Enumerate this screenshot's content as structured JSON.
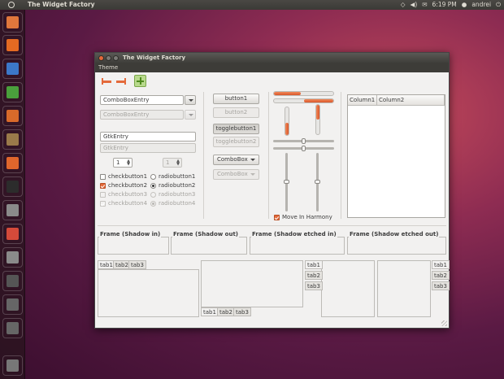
{
  "top_panel": {
    "app_title": "The Widget Factory",
    "clock": "6:19 PM",
    "user": "andrei",
    "indicator_icons": [
      "network-icon",
      "volume-icon",
      "mail-icon",
      "power-icon"
    ]
  },
  "launcher": {
    "items": [
      {
        "name": "home-folder",
        "color": "#e0773c"
      },
      {
        "name": "firefox",
        "color": "#e46a22"
      },
      {
        "name": "libreoffice-writer",
        "color": "#3c78c8"
      },
      {
        "name": "libreoffice-calc",
        "color": "#4aa03c"
      },
      {
        "name": "libreoffice-impress",
        "color": "#d86a2a"
      },
      {
        "name": "shotwell",
        "color": "#9a7a4a"
      },
      {
        "name": "ubuntu-software-center",
        "color": "#e0662c"
      },
      {
        "name": "terminal",
        "color": "#2c2c2c"
      },
      {
        "name": "text-editor",
        "color": "#8a8a8a"
      },
      {
        "name": "system-settings",
        "color": "#d44a3a"
      },
      {
        "name": "help",
        "color": "#8a8a8a"
      },
      {
        "name": "workspace-switcher",
        "color": "#555555"
      },
      {
        "name": "zoom-in",
        "color": "#666666"
      },
      {
        "name": "zoom-fit",
        "color": "#666666"
      },
      {
        "name": "trash",
        "color": "#777777"
      }
    ]
  },
  "window": {
    "title": "The Widget Factory",
    "menu": "Theme",
    "combo_entry": "ComboBoxEntry",
    "combo_entry_disabled": "ComboBoxEntry",
    "entry": "GtkEntry",
    "entry_disabled": "GtkEntry",
    "spin_value": "1",
    "spin_value_disabled": "1",
    "checks": [
      {
        "label": "checkbutton1",
        "checked": false,
        "disabled": false
      },
      {
        "label": "checkbutton2",
        "checked": true,
        "disabled": false
      },
      {
        "label": "checkbutton3",
        "checked": false,
        "disabled": true
      },
      {
        "label": "checkbutton4",
        "checked": true,
        "disabled": true
      }
    ],
    "radios": [
      {
        "label": "radiobutton1",
        "checked": false,
        "disabled": false
      },
      {
        "label": "radiobutton2",
        "checked": true,
        "disabled": false
      },
      {
        "label": "radiobutton3",
        "checked": false,
        "disabled": true
      },
      {
        "label": "radiobutton4",
        "checked": true,
        "disabled": true
      }
    ],
    "button1": "button1",
    "button2": "button2",
    "toggle1": "togglebutton1",
    "toggle2": "togglebutton2",
    "combobox": "ComboBox",
    "combobox_disabled": "ComboBox",
    "progress_h1": 0.45,
    "progress_h2": 0.5,
    "progress_v1": 0.45,
    "progress_v2": 0.5,
    "move_in_harmony": "Move In Harmony",
    "columns": [
      "Column1",
      "Column2"
    ],
    "frames": [
      "Frame (Shadow in)",
      "Frame (Shadow out)",
      "Frame (Shadow etched in)",
      "Frame (Shadow etched out)"
    ],
    "tabs": [
      "tab1",
      "tab2",
      "tab3"
    ]
  }
}
